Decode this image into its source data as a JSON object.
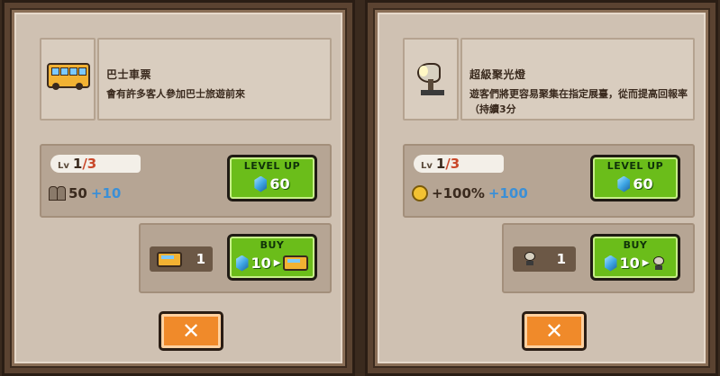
{
  "panels": [
    {
      "item_icon": "bus-icon",
      "title": "巴士車票",
      "description": "會有許多客人參加巴士旅遊前來",
      "level": {
        "prefix": "Lv",
        "current": "1",
        "max": "/3"
      },
      "stat": {
        "icon": "people-icon",
        "base": "50",
        "bonus": "+10"
      },
      "level_up": {
        "label": "LEVEL UP",
        "cost": "60",
        "cost_icon": "gem-icon"
      },
      "owned": {
        "icon": "bus-icon",
        "count": "1"
      },
      "buy": {
        "label": "BUY",
        "cost": "10",
        "cost_icon": "gem-icon",
        "product_icon": "bus-icon"
      },
      "close": {
        "label": "✕"
      }
    },
    {
      "item_icon": "spotlight-icon",
      "title": "超級聚光燈",
      "description": "遊客們將更容易聚集在指定展臺，從而提高回報率（持續3分",
      "level": {
        "prefix": "Lv",
        "current": "1",
        "max": "/3"
      },
      "stat": {
        "icon": "coin-icon",
        "base": "+100%",
        "bonus": "+100"
      },
      "level_up": {
        "label": "LEVEL UP",
        "cost": "60",
        "cost_icon": "gem-icon"
      },
      "owned": {
        "icon": "spotlight-icon",
        "count": "1"
      },
      "buy": {
        "label": "BUY",
        "cost": "10",
        "cost_icon": "gem-icon",
        "product_icon": "spotlight-icon"
      },
      "close": {
        "label": "✕"
      }
    }
  ],
  "colors": {
    "frame_dark": "#3a2a1e",
    "panel_bg": "#cfc1b2",
    "button_green": "#6bbd1a",
    "close_orange": "#f08a2a",
    "level_max_red": "#c9482a",
    "bonus_blue": "#3b8fd6"
  }
}
